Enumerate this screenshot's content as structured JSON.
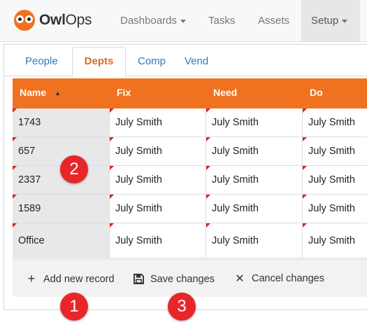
{
  "app": {
    "brand_bold": "Owl",
    "brand_light": "Ops"
  },
  "nav": {
    "items": [
      {
        "label": "Dashboards",
        "dropdown": true
      },
      {
        "label": "Tasks"
      },
      {
        "label": "Assets"
      },
      {
        "label": "Setup",
        "dropdown": true,
        "active": true
      }
    ]
  },
  "tabs": [
    {
      "label": "People"
    },
    {
      "label": "Depts",
      "active": true
    },
    {
      "label": "Comp"
    },
    {
      "label": "Vend"
    }
  ],
  "grid": {
    "columns": [
      "Name",
      "Fix",
      "Need",
      "Do"
    ],
    "sort_indicator": "▲",
    "rows": [
      [
        "1743",
        "July Smith",
        "July Smith",
        "July Smith"
      ],
      [
        "657",
        "July Smith",
        "July Smith",
        "July Smith"
      ],
      [
        "2337",
        "July Smith",
        "July Smith",
        "July Smith"
      ],
      [
        "1589",
        "July Smith",
        "July Smith",
        "July Smith"
      ],
      [
        "Office",
        "July Smith",
        "July Smith",
        "July Smith"
      ]
    ]
  },
  "toolbar": {
    "add_label": "Add new record",
    "save_label": "Save changes",
    "cancel_label": "Cancel changes"
  },
  "badges": {
    "one": "1",
    "two": "2",
    "three": "3"
  },
  "colors": {
    "accent": "#f07221",
    "badge": "#e8262a",
    "link": "#337ab7"
  }
}
